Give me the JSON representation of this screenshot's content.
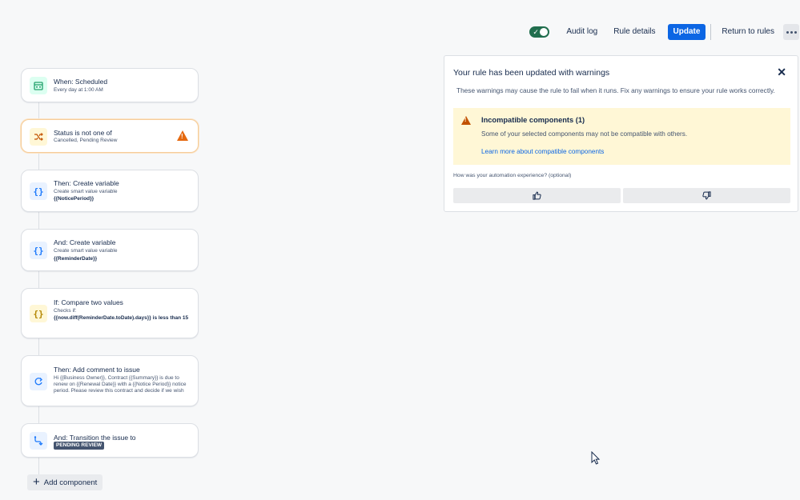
{
  "toolbar": {
    "toggle_on": true,
    "audit_log": "Audit log",
    "rule_details": "Rule details",
    "update": "Update",
    "return_to_rules": "Return to rules"
  },
  "rule": {
    "components": [
      {
        "title": "When: Scheduled",
        "subtitle": "Every day at 1:00 AM",
        "icon": "calendar-icon"
      },
      {
        "title": "Status is not one of",
        "subtitle": "Cancelled, Pending Review",
        "icon": "shuffle-icon",
        "warning": true
      },
      {
        "title": "Then: Create variable",
        "subtitle": "Create smart value variable",
        "detail": "{{NoticePeriod}}",
        "icon": "curly-braces-icon"
      },
      {
        "title": "And: Create variable",
        "subtitle": "Create smart value variable",
        "detail": "{{ReminderDate}}",
        "icon": "curly-braces-icon"
      },
      {
        "title": "If: Compare two values",
        "subtitle": "Checks if:",
        "detail": "{{now.diff(ReminderDate.toDate).days}} is less than 15",
        "icon": "curly-braces-icon"
      },
      {
        "title": "Then: Add comment to issue",
        "subtitle": "Hi {{Business Owner}}, Contract {{Summary}} is due to renew on {{Renewal Date}} with a {{Notice Period}} notice period. Please review this contract and decide if we wish",
        "icon": "comment-icon"
      },
      {
        "title": "And: Transition the issue to",
        "status": "PENDING REVIEW",
        "icon": "transition-icon"
      }
    ],
    "add_component": "Add component"
  },
  "panel": {
    "title": "Your rule has been updated with warnings",
    "description": "These warnings may cause the rule to fail when it runs. Fix any warnings to ensure your rule works correctly.",
    "warning_title": "Incompatible components (1)",
    "warning_text": "Some of your selected components may not be compatible with others.",
    "warning_link": "Learn more about compatible components",
    "feedback_question": "How was your automation experience? (optional)"
  },
  "colors": {
    "primary": "#0c66e4",
    "toggle": "#216e4e",
    "warning": "#e56910",
    "warning_bg": "#fff7d6"
  }
}
